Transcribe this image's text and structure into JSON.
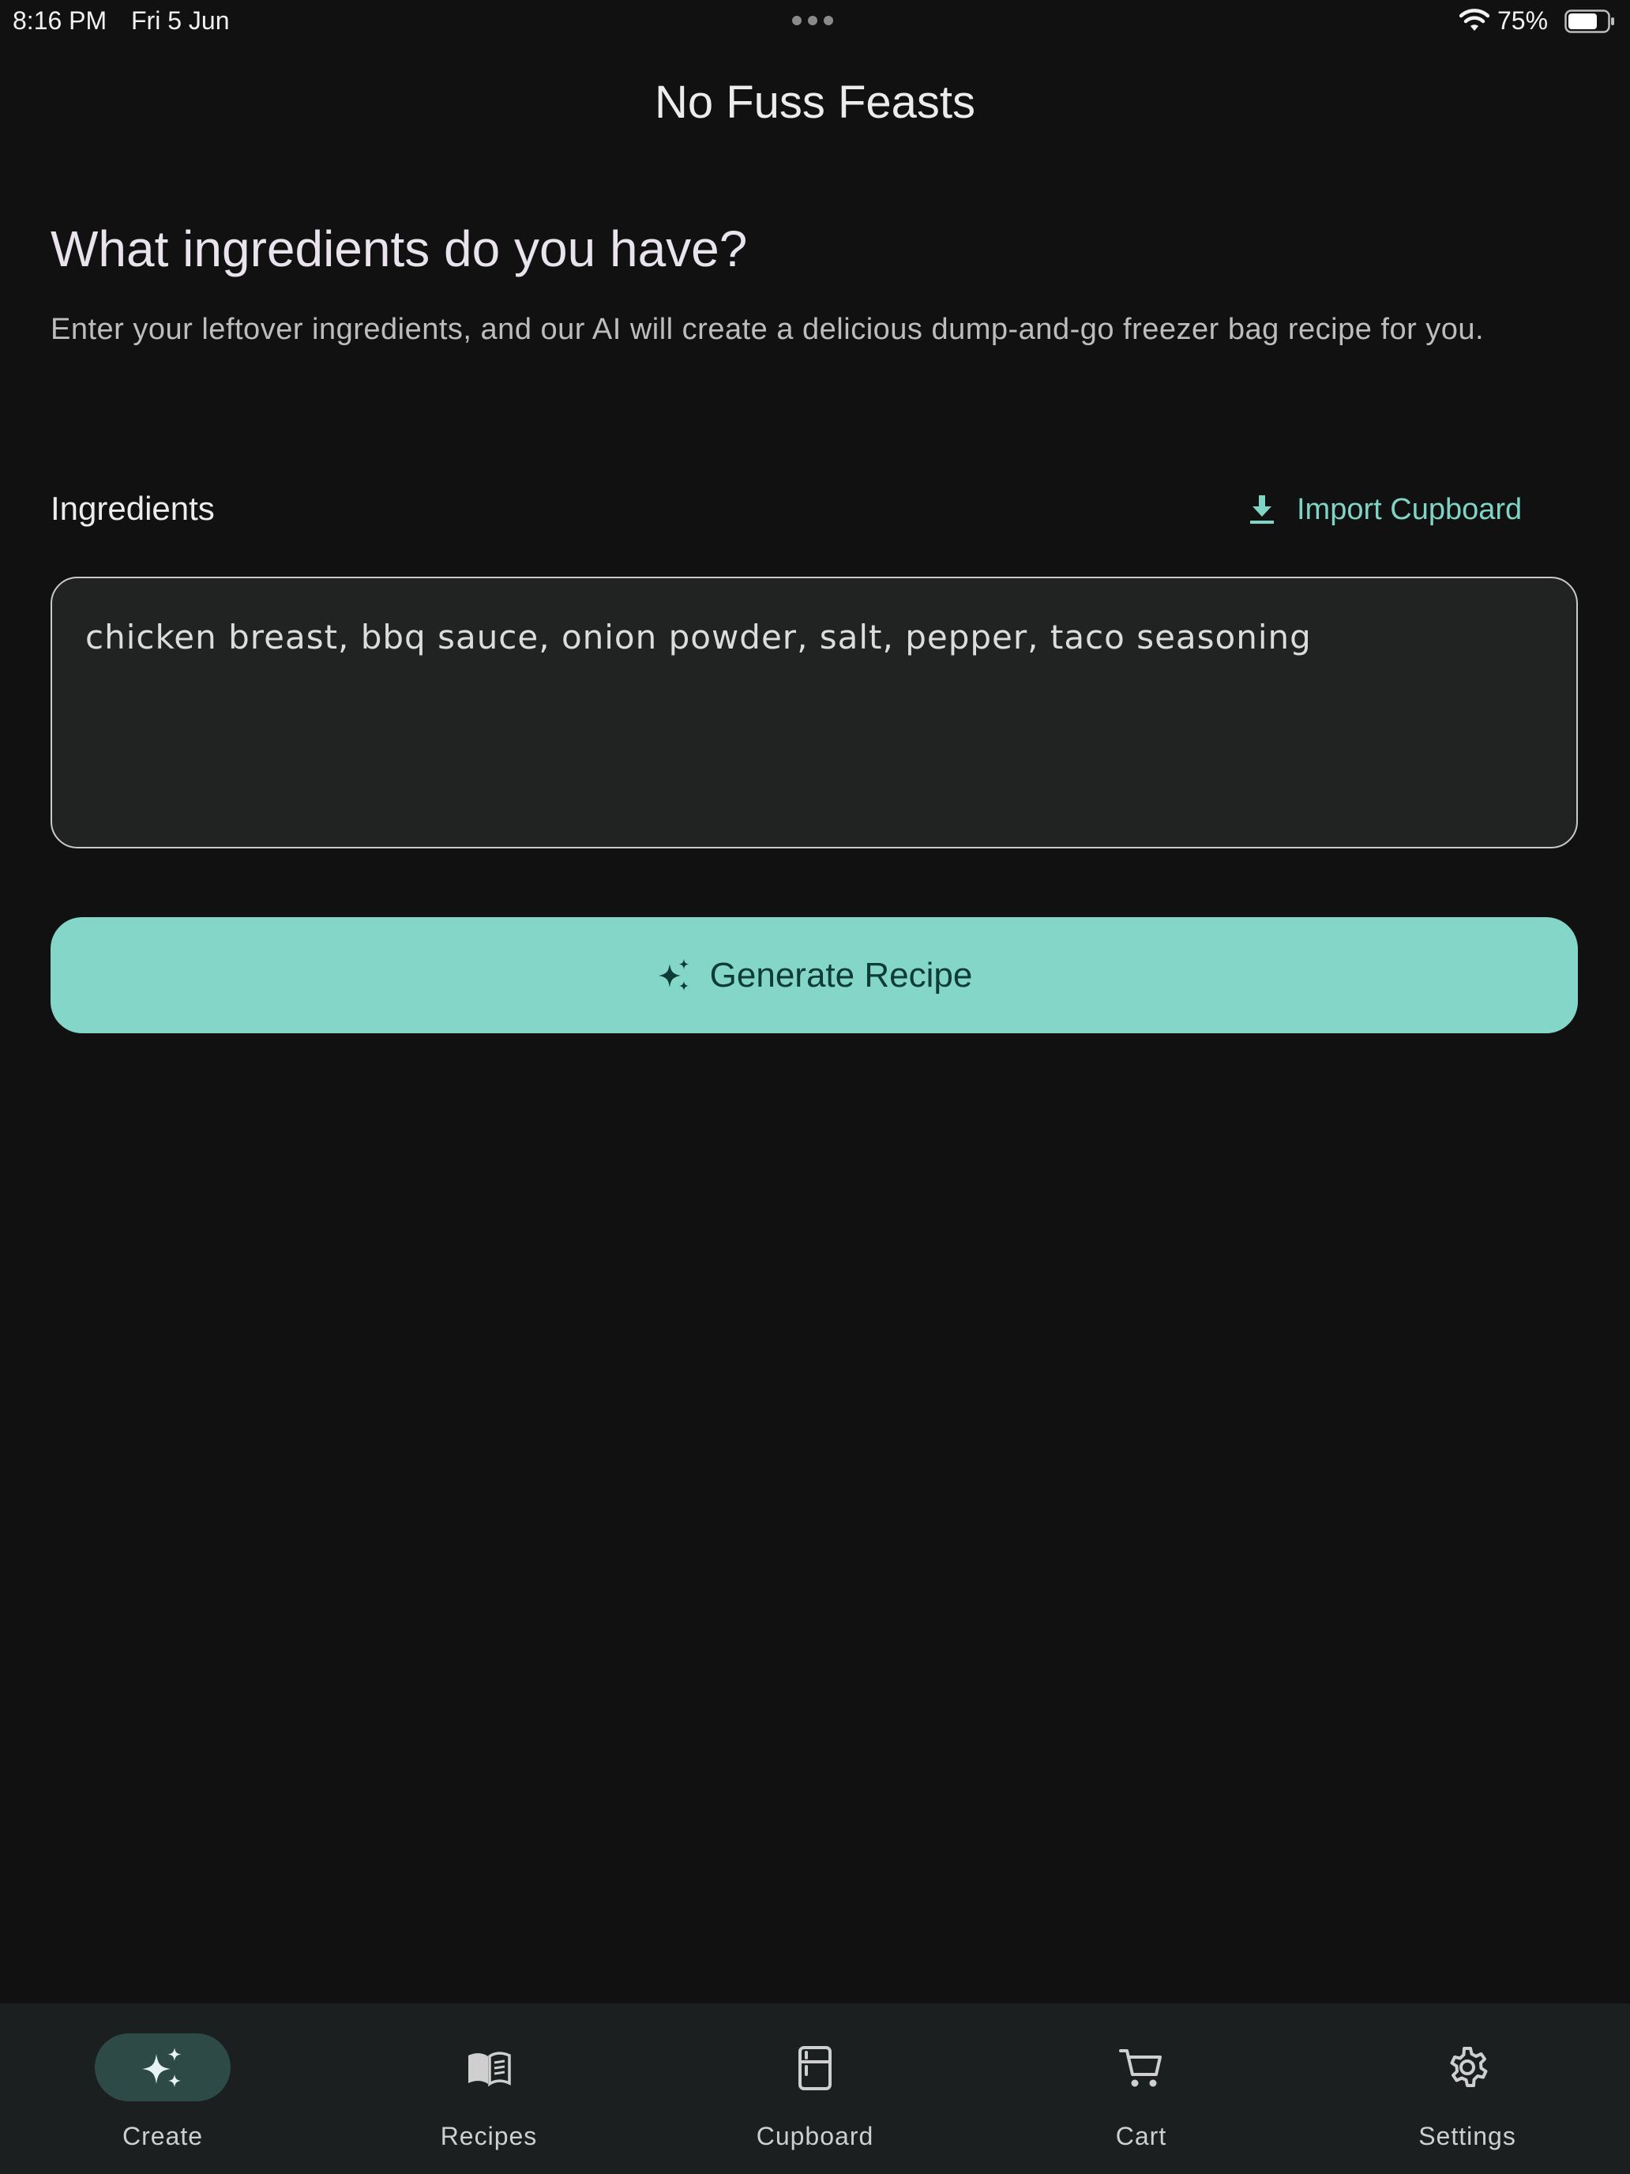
{
  "status_bar": {
    "time": "8:16 PM",
    "date": "Fri 5 Jun",
    "battery": "75%",
    "battery_level": 0.75
  },
  "header": {
    "title": "No Fuss Feasts"
  },
  "main": {
    "heading": "What ingredients do you have?",
    "subtitle": "Enter your leftover ingredients, and our AI will create a delicious dump-and-go freezer bag recipe for you.",
    "ingredients_label": "Ingredients",
    "import_label": "Import Cupboard",
    "ingredients_value": "chicken breast, bbq sauce, onion powder, salt, pepper, taco seasoning",
    "generate_label": "Generate Recipe"
  },
  "bottom_nav": {
    "items": [
      {
        "label": "Create",
        "icon": "sparkles-icon",
        "active": true
      },
      {
        "label": "Recipes",
        "icon": "book-icon",
        "active": false
      },
      {
        "label": "Cupboard",
        "icon": "cupboard-icon",
        "active": false
      },
      {
        "label": "Cart",
        "icon": "cart-icon",
        "active": false
      },
      {
        "label": "Settings",
        "icon": "gear-icon",
        "active": false
      }
    ]
  },
  "colors": {
    "background": "#111111",
    "accent": "#84d6c8",
    "accent_text": "#7fd4c5",
    "nav_background": "#1b1f1f",
    "nav_active_pill": "#2e4a46"
  }
}
